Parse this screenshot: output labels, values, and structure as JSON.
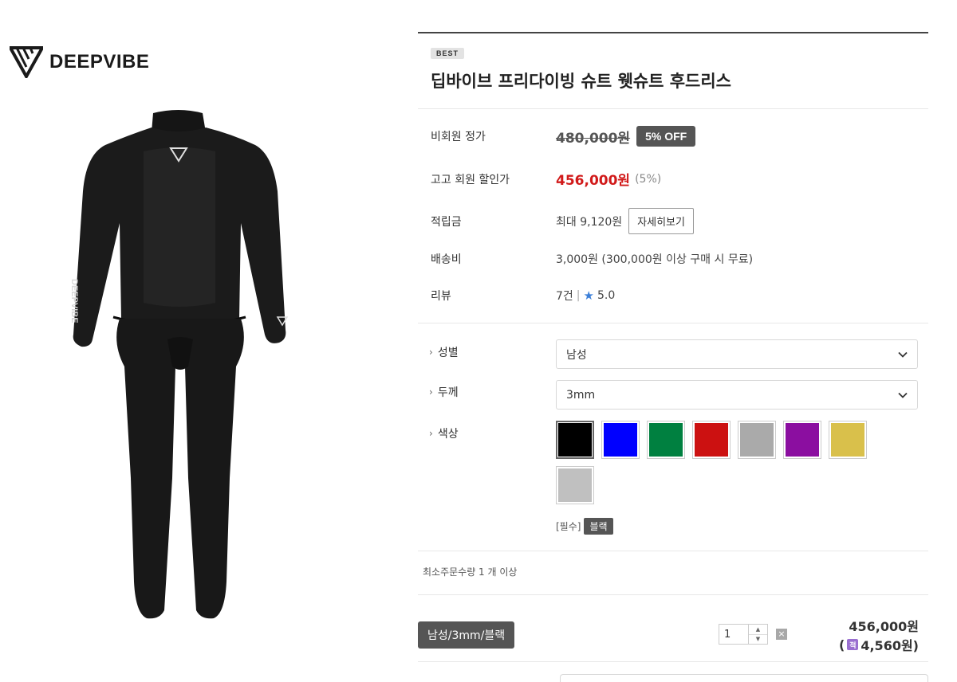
{
  "brand": {
    "name": "DEEPVIBE"
  },
  "product": {
    "badge": "BEST",
    "title": "딥바이브 프리다이빙 슈트 웻슈트 후드리스",
    "image_chest_logo": "deepvibe-logo",
    "image_sleeve_text": "DEEPVIBE"
  },
  "info": {
    "list_price": {
      "label": "비회원 정가",
      "value": "480,000원",
      "discount_badge": "5% OFF"
    },
    "member_price": {
      "label": "고고 회원 할인가",
      "value": "456,000원",
      "pct": "(5%)"
    },
    "points": {
      "label": "적립금",
      "value": "최대 9,120원",
      "button": "자세히보기"
    },
    "shipping": {
      "label": "배송비",
      "value": "3,000원 (300,000원 이상 구매 시 무료)"
    },
    "review": {
      "label": "리뷰",
      "count": "7건",
      "separator": "|",
      "rating": "5.0"
    }
  },
  "options": {
    "gender": {
      "label": "성별",
      "selected": "남성"
    },
    "thickness": {
      "label": "두께",
      "selected": "3mm"
    },
    "color": {
      "label": "색상",
      "swatches": [
        "#000000",
        "#0000ff",
        "#008040",
        "#cc1111",
        "#aaaaaa",
        "#8b0ea0",
        "#d9c04b",
        "#c0c0c0"
      ],
      "selected_index": 0,
      "required_prefix": "[필수]",
      "selected_name": "블랙"
    }
  },
  "order": {
    "min_qty_text": "최소주문수량 1 개 이상",
    "selection_tag": "남성/3mm/블랙",
    "quantity": "1",
    "remove_symbol": "×",
    "price": "456,000원",
    "points_open": "(",
    "points_icon": "적",
    "points": "4,560원)"
  },
  "colors": {
    "sale": "#d11a1a",
    "badge_bg": "#555555",
    "star": "#3c7fd8"
  }
}
